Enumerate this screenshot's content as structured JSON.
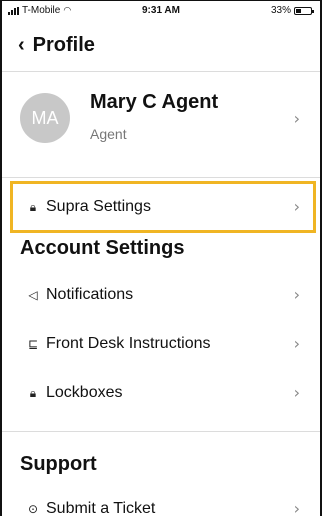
{
  "status_bar": {
    "carrier": "T-Mobile",
    "time": "9:31 AM",
    "battery": "33%",
    "battery_level": 0.33
  },
  "nav": {
    "back_icon": "chevron-left-icon",
    "title": "Profile"
  },
  "profile": {
    "initials": "MA",
    "name": "Mary C Agent",
    "role": "Agent"
  },
  "menu": {
    "supra_settings": "Supra Settings",
    "account_section": "Account Settings",
    "notifications": "Notifications",
    "front_desk": "Front Desk Instructions",
    "lockboxes": "Lockboxes",
    "support_section": "Support",
    "submit_ticket": "Submit a Ticket"
  },
  "icons": {
    "lock": "lock-icon",
    "bell": "bell-icon",
    "desk": "front-desk-icon",
    "help": "help-icon",
    "chevron": "chevron-right-icon"
  },
  "colors": {
    "highlight": "#f0b523",
    "avatar": "#c8c8c8"
  }
}
